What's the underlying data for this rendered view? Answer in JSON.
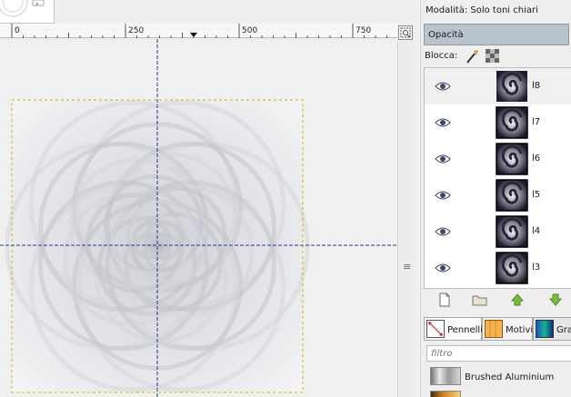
{
  "ruler": {
    "ticks": [
      "0",
      "250",
      "500",
      "750"
    ]
  },
  "layers_panel": {
    "mode_label": "Modalità:",
    "mode_value": "Solo toni chiari",
    "opacity_label": "Opacità",
    "lock_label": "Blocca:",
    "layers": [
      {
        "name": "l8",
        "visible": true,
        "selected": true
      },
      {
        "name": "l7",
        "visible": true,
        "selected": false
      },
      {
        "name": "l6",
        "visible": true,
        "selected": false
      },
      {
        "name": "l5",
        "visible": true,
        "selected": false
      },
      {
        "name": "l4",
        "visible": true,
        "selected": false
      },
      {
        "name": "l3",
        "visible": true,
        "selected": false
      }
    ],
    "tool_icons": [
      "new-layer-icon",
      "folder-icon",
      "raise-layer-icon",
      "lower-layer-icon"
    ]
  },
  "resource_tabs": {
    "tabs": [
      {
        "label": "Pennelli",
        "icon": "brush-tab-icon"
      },
      {
        "label": "Motivi",
        "icon": "pattern-tab-icon"
      },
      {
        "label": "Grad",
        "icon": "gradient-tab-icon"
      }
    ],
    "filter_placeholder": "filtro",
    "gradients": [
      {
        "name": "Brushed Aluminium",
        "color": "#a9a9a9"
      },
      {
        "name": "",
        "color": "#d27d1e"
      }
    ]
  },
  "colors": {
    "guide": "#1f3a8a",
    "selection": "#d4b200",
    "spiral_dark": "#1e1a2e"
  }
}
